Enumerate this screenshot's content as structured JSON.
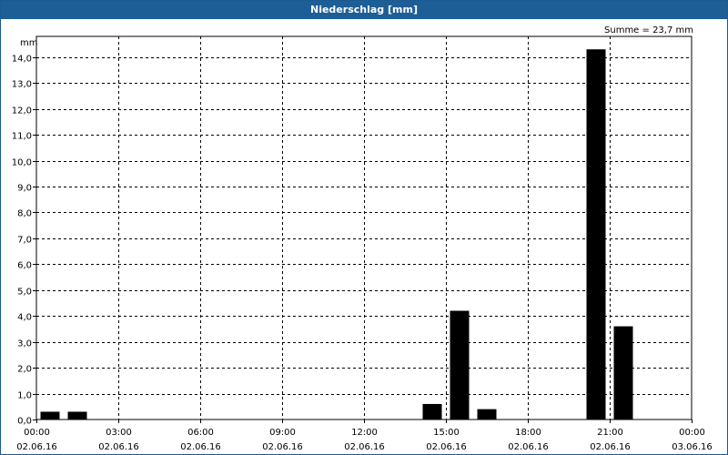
{
  "window": {
    "title": "Niederschlag [mm]"
  },
  "chart_data": {
    "type": "bar",
    "title": "Niederschlag [mm]",
    "ylabel": "mm",
    "xlabel": "",
    "annotation": "Summe = 23,7 mm",
    "ylim": [
      0,
      14.8
    ],
    "y_ticks": [
      "0,0",
      "1,0",
      "2,0",
      "3,0",
      "4,0",
      "5,0",
      "6,0",
      "7,0",
      "8,0",
      "9,0",
      "10,0",
      "11,0",
      "12,0",
      "13,0",
      "14,0"
    ],
    "x_ticks": [
      {
        "time": "00:00",
        "date": "02.06.16"
      },
      {
        "time": "03:00",
        "date": "02.06.16"
      },
      {
        "time": "06:00",
        "date": "02.06.16"
      },
      {
        "time": "09:00",
        "date": "02.06.16"
      },
      {
        "time": "12:00",
        "date": "02.06.16"
      },
      {
        "time": "15:00",
        "date": "02.06.16"
      },
      {
        "time": "18:00",
        "date": "02.06.16"
      },
      {
        "time": "21:00",
        "date": "02.06.16"
      },
      {
        "time": "00:00",
        "date": "03.06.16"
      }
    ],
    "x_range": [
      "02.06.16 00:00",
      "03.06.16 00:00"
    ],
    "bars": [
      {
        "start": "02.06.16 00:00",
        "end": "02.06.16 01:00",
        "value": 0.3
      },
      {
        "start": "02.06.16 01:00",
        "end": "02.06.16 02:00",
        "value": 0.3
      },
      {
        "start": "02.06.16 14:00",
        "end": "02.06.16 15:00",
        "value": 0.6
      },
      {
        "start": "02.06.16 15:00",
        "end": "02.06.16 16:00",
        "value": 4.2
      },
      {
        "start": "02.06.16 16:00",
        "end": "02.06.16 17:00",
        "value": 0.4
      },
      {
        "start": "02.06.16 20:00",
        "end": "02.06.16 21:00",
        "value": 14.3
      },
      {
        "start": "02.06.16 21:00",
        "end": "02.06.16 22:00",
        "value": 3.6
      }
    ],
    "grid": true,
    "colors": {
      "bar": "#000000",
      "grid": "#000000",
      "titlebar": "#1e5e96"
    }
  }
}
